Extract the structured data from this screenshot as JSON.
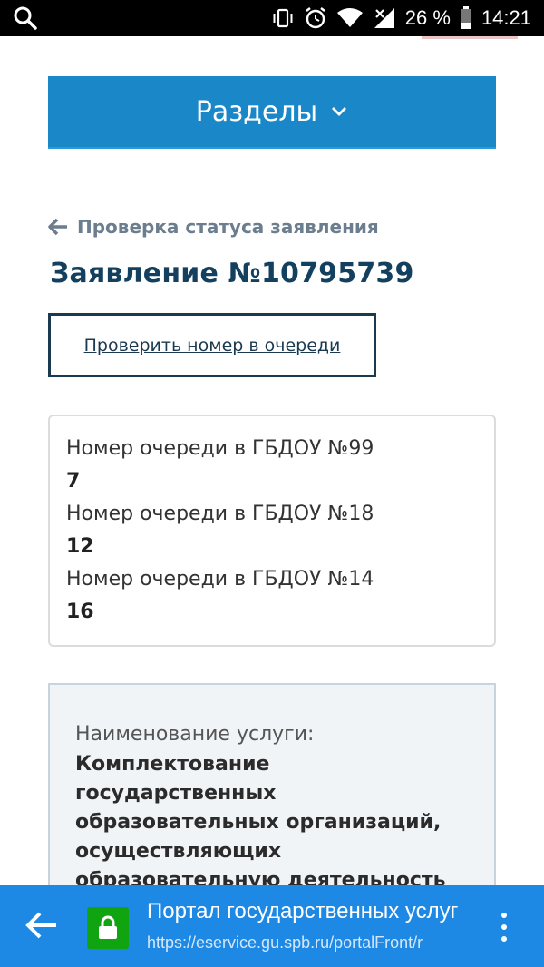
{
  "statusbar": {
    "battery_percent": "26 %",
    "time": "14:21",
    "icons": [
      "search-icon",
      "vibrate-icon",
      "alarm-icon",
      "wifi-icon",
      "signal-icon",
      "battery-icon"
    ]
  },
  "header": {
    "sections_label": "Разделы"
  },
  "breadcrumb": {
    "back_label": "Проверка статуса заявления"
  },
  "application": {
    "title": "Заявление №10795739",
    "check_queue_label": "Проверить номер в очереди"
  },
  "queue": {
    "items": [
      {
        "label": "Номер очереди в ГБДОУ №99",
        "value": "7"
      },
      {
        "label": "Номер очереди в ГБДОУ №18",
        "value": "12"
      },
      {
        "label": "Номер очереди в ГБДОУ №14",
        "value": "16"
      }
    ]
  },
  "service": {
    "label": "Наименование услуги:",
    "value_lines": [
      "Комплектование",
      "государственных",
      "образовательных организаций,",
      "осуществляющих",
      "образовательную деятельность"
    ]
  },
  "browser": {
    "page_title": "Портал государственных услуг",
    "url": "https://eservice.gu.spb.ru/portalFront/r",
    "colors": {
      "bar": "#1e88e5",
      "lock": "#10a410"
    }
  },
  "colors": {
    "accent": "#1a88c8",
    "title": "#14405f"
  }
}
